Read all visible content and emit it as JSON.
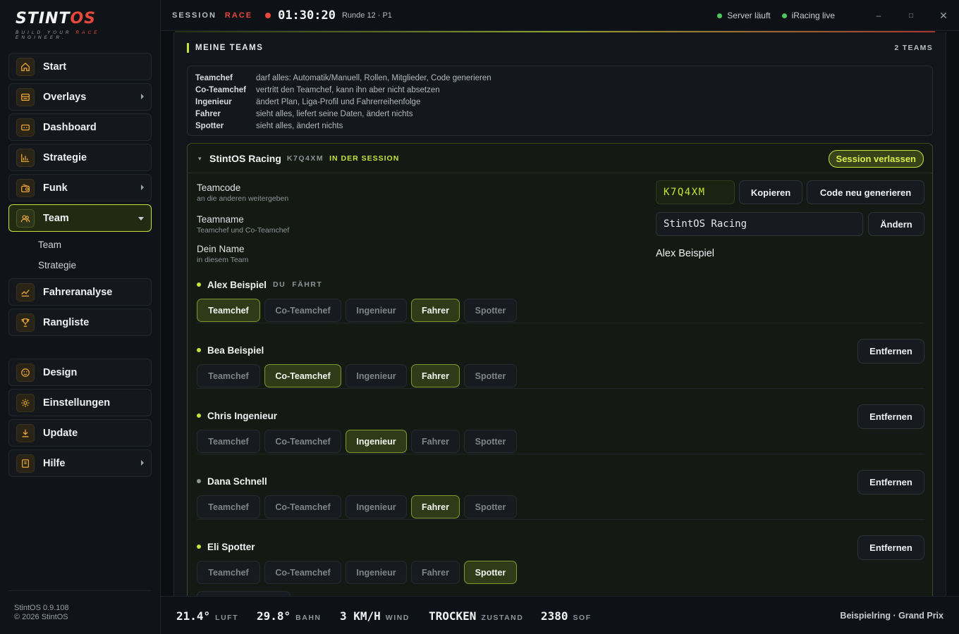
{
  "app": {
    "logo_text_a": "STINT",
    "logo_text_b": "OS",
    "logo_tag_a": "BUILD YOUR ",
    "logo_tag_b": "RACE",
    "logo_tag_c": " ENGINEER.",
    "version": "StintOS 0.9.108",
    "copyright": "© 2026 StintOS"
  },
  "sidebar": {
    "items": [
      {
        "label": "Start",
        "icon": "home-icon"
      },
      {
        "label": "Overlays",
        "icon": "overlay-icon"
      },
      {
        "label": "Dashboard",
        "icon": "dashboard-icon"
      },
      {
        "label": "Strategie",
        "icon": "chart-icon"
      },
      {
        "label": "Funk",
        "icon": "radio-icon"
      },
      {
        "label": "Team",
        "icon": "team-icon"
      },
      {
        "label": "Fahreranalyse",
        "icon": "trend-icon"
      },
      {
        "label": "Rangliste",
        "icon": "trophy-icon"
      },
      {
        "label": "Design",
        "icon": "palette-icon"
      },
      {
        "label": "Einstellungen",
        "icon": "gear-icon"
      },
      {
        "label": "Update",
        "icon": "download-icon"
      },
      {
        "label": "Hilfe",
        "icon": "book-icon"
      }
    ],
    "team_sub": [
      "Team",
      "Strategie"
    ]
  },
  "topbar": {
    "session_label": "SESSION",
    "session_type": "RACE",
    "timer": "01:30:20",
    "lap": "Runde 12 · P1",
    "server_status": "Server läuft",
    "iracing_status": "iRacing live"
  },
  "section": {
    "title": "MEINE TEAMS",
    "count": "2 TEAMS"
  },
  "roles_info": [
    {
      "name": "Teamchef",
      "desc": "darf alles: Automatik/Manuell, Rollen, Mitglieder, Code generieren"
    },
    {
      "name": "Co-Teamchef",
      "desc": "vertritt den Teamchef, kann ihn aber nicht absetzen"
    },
    {
      "name": "Ingenieur",
      "desc": "ändert Plan, Liga-Profil und Fahrerreihenfolge"
    },
    {
      "name": "Fahrer",
      "desc": "sieht alles, liefert seine Daten, ändert nichts"
    },
    {
      "name": "Spotter",
      "desc": "sieht alles, ändert nichts"
    }
  ],
  "team": {
    "name": "StintOS Racing",
    "code": "K7Q4XM",
    "session_badge": "IN DER SESSION",
    "leave_label": "Session verlassen",
    "teamcode_label": "Teamcode",
    "teamcode_sub": "an die anderen weitergeben",
    "copy_label": "Kopieren",
    "regen_label": "Code neu generieren",
    "teamname_label": "Teamname",
    "teamname_sub": "Teamchef und Co-Teamchef",
    "teamname_value": "StintOS Racing",
    "change_label": "Ändern",
    "myname_label": "Dein Name",
    "myname_sub": "in diesem Team",
    "myname_value": "Alex Beispiel"
  },
  "role_labels": [
    "Teamchef",
    "Co-Teamchef",
    "Ingenieur",
    "Fahrer",
    "Spotter"
  ],
  "remove_label": "Entfernen",
  "members": [
    {
      "name": "Alex Beispiel",
      "tag_you": "DU",
      "tag_driving": "FÄHRT",
      "active": [
        "Teamchef",
        "Fahrer"
      ],
      "online": true
    },
    {
      "name": "Bea Beispiel",
      "active": [
        "Co-Teamchef",
        "Fahrer"
      ],
      "online": true
    },
    {
      "name": "Chris Ingenieur",
      "active": [
        "Ingenieur"
      ],
      "online": true
    },
    {
      "name": "Dana Schnell",
      "active": [
        "Fahrer"
      ],
      "online": false
    },
    {
      "name": "Eli Spotter",
      "active": [
        "Spotter"
      ],
      "online": true
    }
  ],
  "bottombar": {
    "air_value": "21.4°",
    "air_unit": "LUFT",
    "track_value": "29.8°",
    "track_unit": "BAHN",
    "wind_value": "3 KM/H",
    "wind_unit": "WIND",
    "cond_value": "TROCKEN",
    "cond_unit": "ZUSTAND",
    "sof_value": "2380",
    "sof_unit": "SOF",
    "track_name": "Beispielring · Grand Prix"
  },
  "colors": {
    "accent": "#c8e23a",
    "race": "#e8483b",
    "ok": "#4ec75e",
    "icon": "#e8a53a"
  }
}
